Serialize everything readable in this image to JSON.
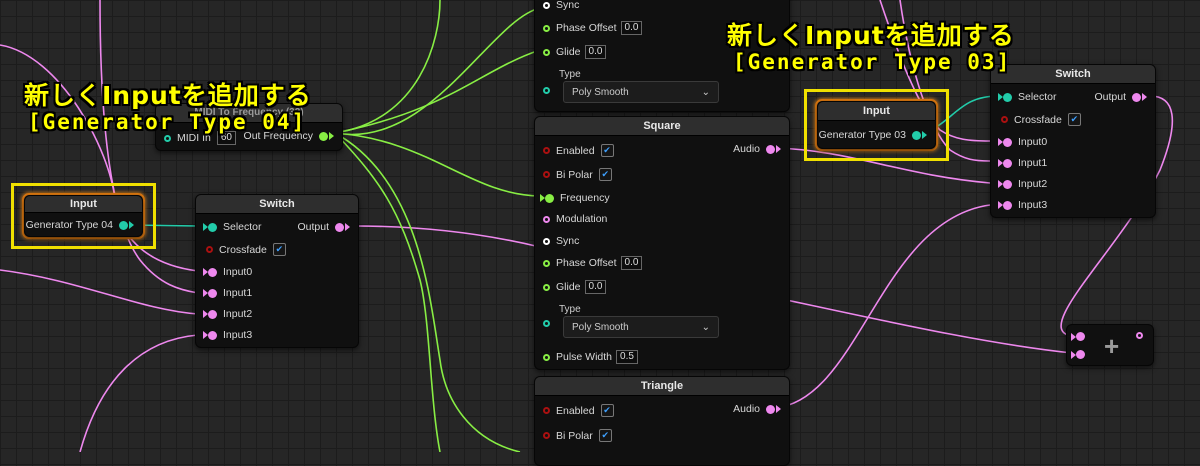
{
  "colors": {
    "audio_pin": "#ee88ee",
    "float_pin": "#88ee44",
    "int_pin": "#22ccaa",
    "bool_pin": "#aa1010",
    "trigger_pin": "#ffffff",
    "highlight": "#f0e000",
    "selection": "#e07a10",
    "annotation_text": "#ffff00"
  },
  "annotations": {
    "left_line1": "新しくInputを追加する",
    "left_line2": "[Generator Type 04]",
    "right_line1": "新しくInputを追加する",
    "right_line2": "[Generator Type 03]"
  },
  "midi_node": {
    "title": "MIDI To Frequency (32)",
    "in_label": "MIDI In",
    "in_value": "60",
    "out_label": "Out Frequency"
  },
  "input_node_left": {
    "title": "Input",
    "pin_label": "Generator Type 04"
  },
  "input_node_right": {
    "title": "Input",
    "pin_label": "Generator Type 03"
  },
  "switch_left": {
    "title": "Switch",
    "selector": "Selector",
    "crossfade": "Crossfade",
    "output": "Output",
    "inputs": [
      "Input0",
      "Input1",
      "Input2",
      "Input3"
    ]
  },
  "switch_right": {
    "title": "Switch",
    "selector": "Selector",
    "crossfade": "Crossfade",
    "output": "Output",
    "inputs": [
      "Input0",
      "Input1",
      "Input2",
      "Input3"
    ]
  },
  "top_partial_node": {
    "sync": "Sync",
    "phase_offset": "Phase Offset",
    "phase_offset_value": "0.0",
    "glide": "Glide",
    "glide_value": "0.0",
    "type_label": "Type",
    "type_value": "Poly Smooth"
  },
  "square_node": {
    "title": "Square",
    "enabled": "Enabled",
    "bipolar": "Bi Polar",
    "frequency": "Frequency",
    "modulation": "Modulation",
    "sync": "Sync",
    "phase_offset": "Phase Offset",
    "phase_offset_value": "0.0",
    "glide": "Glide",
    "glide_value": "0.0",
    "type_label": "Type",
    "type_value": "Poly Smooth",
    "pulse_width": "Pulse Width",
    "pulse_width_value": "0.5",
    "audio_out": "Audio"
  },
  "triangle_node": {
    "title": "Triangle",
    "enabled": "Enabled",
    "bipolar": "Bi Polar",
    "audio_out": "Audio"
  },
  "add_node": {
    "symbol": "+"
  }
}
